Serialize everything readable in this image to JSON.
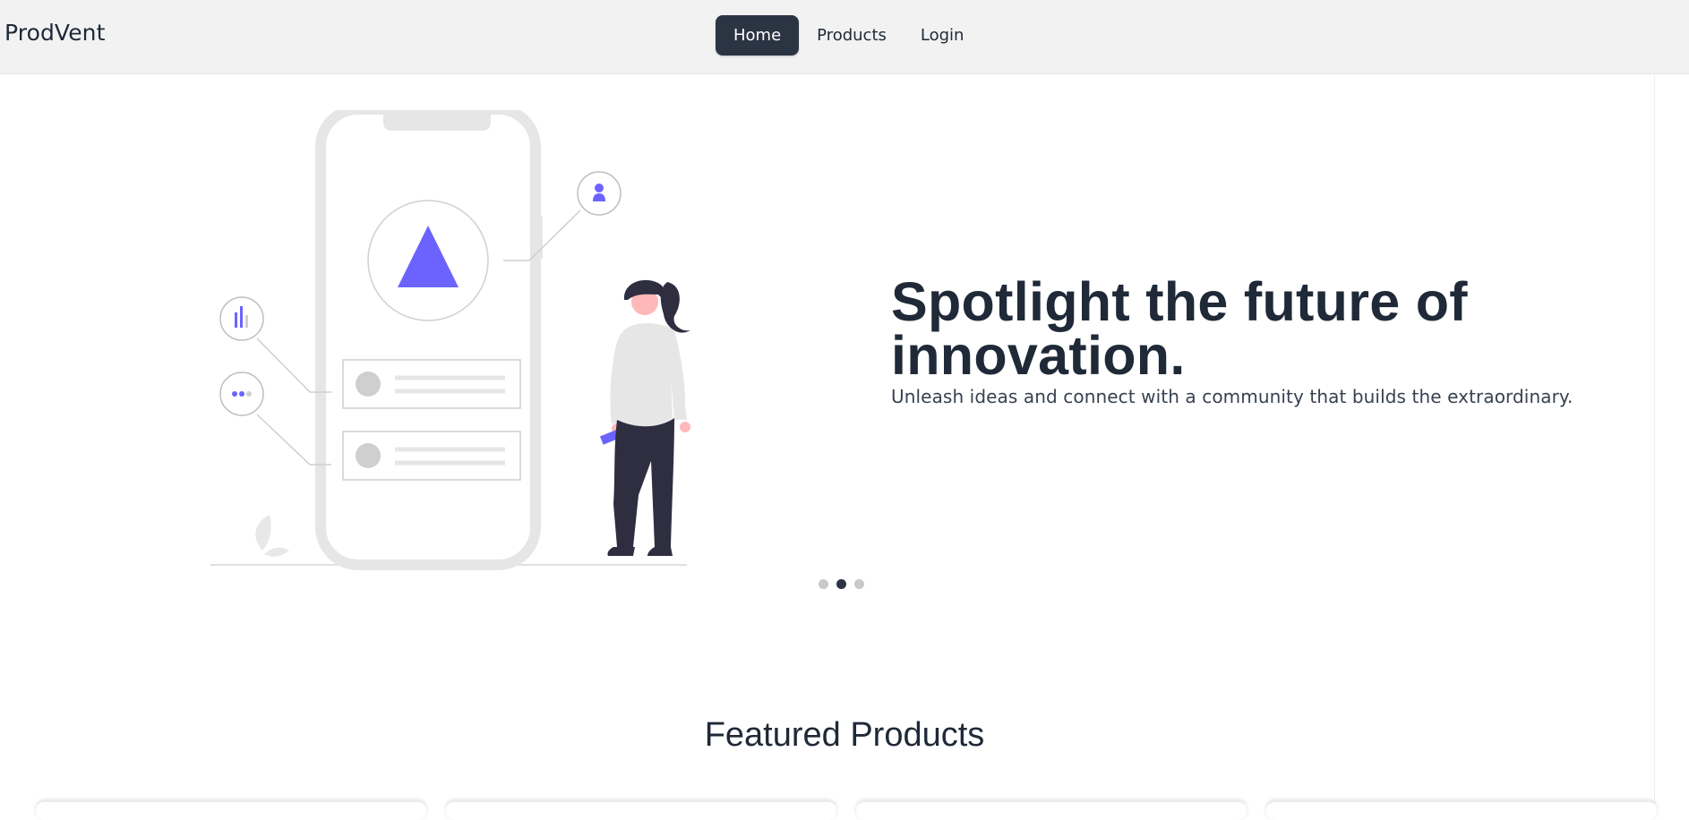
{
  "brand": "ProdVent",
  "nav": {
    "items": [
      "Home",
      "Products",
      "Login"
    ],
    "active": "Home"
  },
  "hero": {
    "headline_line1": "Spotlight the future of",
    "headline_line2": "innovation.",
    "subtitle": "Unleash ideas and connect with a community that builds the extraordinary.",
    "slide_count": 3,
    "active_slide": 2
  },
  "featured": {
    "title": "Featured Products",
    "card_count": 4
  },
  "colors": {
    "navbar_bg": "#f2f2f2",
    "active_nav_bg": "#2b3443",
    "accent_purple": "#6c63ff",
    "illustration_gray": "#e6e6e6",
    "text_dark": "#1f2937"
  },
  "icons": {
    "phone_top_icon": "triangle-icon",
    "bubble_top_right": "user-icon",
    "bubble_left_top": "bar-chart-icon",
    "bubble_left_bottom": "more-dots-icon"
  }
}
